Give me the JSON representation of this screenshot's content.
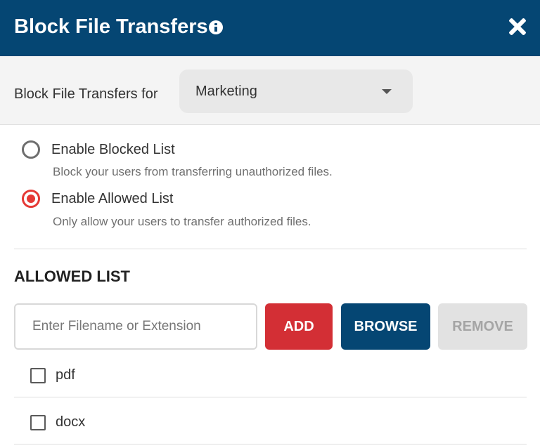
{
  "dialog": {
    "title": "Block File Transfers",
    "close_icon": "close-icon",
    "info_icon": "info-icon"
  },
  "group_selector": {
    "label": "Block File Transfers for",
    "selected": "Marketing"
  },
  "mode_options": [
    {
      "label": "Enable Blocked List",
      "description": "Block your users from transferring unauthorized files.",
      "checked": false
    },
    {
      "label": "Enable Allowed List",
      "description": "Only allow your users to transfer authorized files.",
      "checked": true
    }
  ],
  "allowed_list": {
    "heading": "ALLOWED LIST",
    "input_placeholder": "Enter Filename or Extension",
    "input_value": "",
    "buttons": {
      "add": "ADD",
      "browse": "BROWSE",
      "remove": "REMOVE"
    },
    "items": [
      {
        "label": "pdf",
        "checked": false
      },
      {
        "label": "docx",
        "checked": false
      }
    ]
  },
  "colors": {
    "header_bg": "#054673",
    "accent_red": "#d32f35",
    "radio_selected": "#e53935",
    "primary_blue": "#054673",
    "disabled_gray": "#e2e2e2"
  }
}
